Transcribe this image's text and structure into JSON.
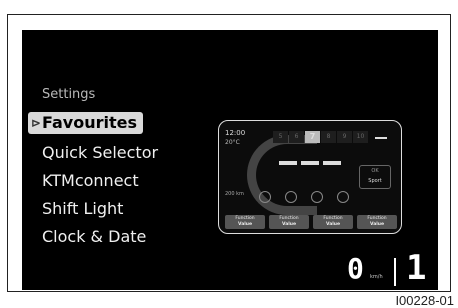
{
  "menu": {
    "title": "Settings",
    "items": [
      {
        "label": "Favourites",
        "selected": true
      },
      {
        "label": "Quick Selector",
        "selected": false
      },
      {
        "label": "KTMconnect",
        "selected": false
      },
      {
        "label": "Shift Light",
        "selected": false
      },
      {
        "label": "Clock & Date",
        "selected": false
      }
    ]
  },
  "preview": {
    "time": "12:00",
    "temp": "20°C",
    "fuel": "200 km",
    "rpm": [
      "5",
      "6",
      "7",
      "8",
      "9",
      "10"
    ],
    "mode_label": "OK",
    "mode_value": "Sport",
    "functions": [
      {
        "name": "Function",
        "value": "Value"
      },
      {
        "name": "Function",
        "value": "Value"
      },
      {
        "name": "Function",
        "value": "Value"
      },
      {
        "name": "Function",
        "value": "Value"
      }
    ]
  },
  "status": {
    "speed": "0",
    "speed_unit": "km/h",
    "gear": "1"
  },
  "figure_id": "I00228-01"
}
